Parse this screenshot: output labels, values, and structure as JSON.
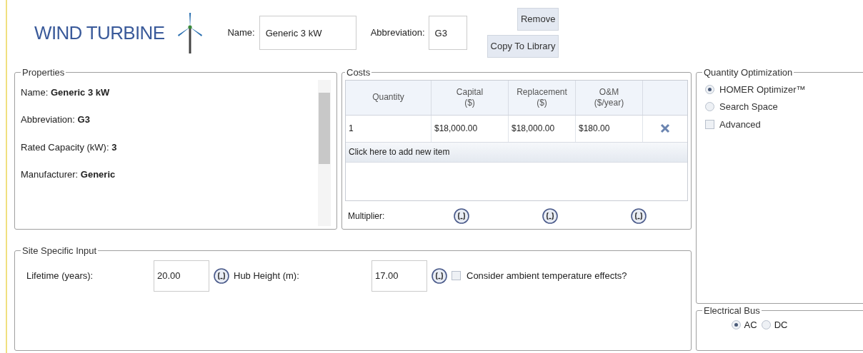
{
  "header": {
    "title": "WIND TURBINE",
    "name_label": "Name:",
    "name_value": "Generic 3 kW",
    "abbr_label": "Abbreviation:",
    "abbr_value": "G3",
    "buttons": [
      "Remove",
      "Copy To Library"
    ]
  },
  "properties": {
    "title": "Properties",
    "items": [
      {
        "label": "Name:",
        "value": "Generic 3 kW"
      },
      {
        "label": "Abbreviation:",
        "value": "G3"
      },
      {
        "label": "Rated Capacity (kW):",
        "value": "3"
      },
      {
        "label": "Manufacturer:",
        "value": "Generic"
      }
    ]
  },
  "costs": {
    "title": "Costs",
    "columns": [
      "Quantity",
      "Capital\n($)",
      "Replacement\n($)",
      "O&M\n($/year)"
    ],
    "rows": [
      [
        "1",
        "$18,000.00",
        "$18,000.00",
        "$180.00"
      ]
    ],
    "add_item": "Click here to add new item",
    "multiplier_label": "Multiplier:"
  },
  "site": {
    "title": "Site Specific Input",
    "lifetime_label": "Lifetime (years):",
    "lifetime_value": "20.00",
    "hub_label": "Hub Height (m):",
    "hub_value": "17.00",
    "ambient_label": "Consider ambient temperature effects?",
    "ambient_checked": false
  },
  "optimization": {
    "title": "Quantity Optimization",
    "options": [
      {
        "kind": "radio",
        "label": "HOMER Optimizer™",
        "selected": true
      },
      {
        "kind": "radio",
        "label": "Search Space",
        "selected": false
      },
      {
        "kind": "checkbox",
        "label": "Advanced",
        "checked": false
      }
    ]
  },
  "bus": {
    "title": "Electrical Bus",
    "options": [
      {
        "label": "AC",
        "selected": true
      },
      {
        "label": "DC",
        "selected": false
      }
    ]
  }
}
